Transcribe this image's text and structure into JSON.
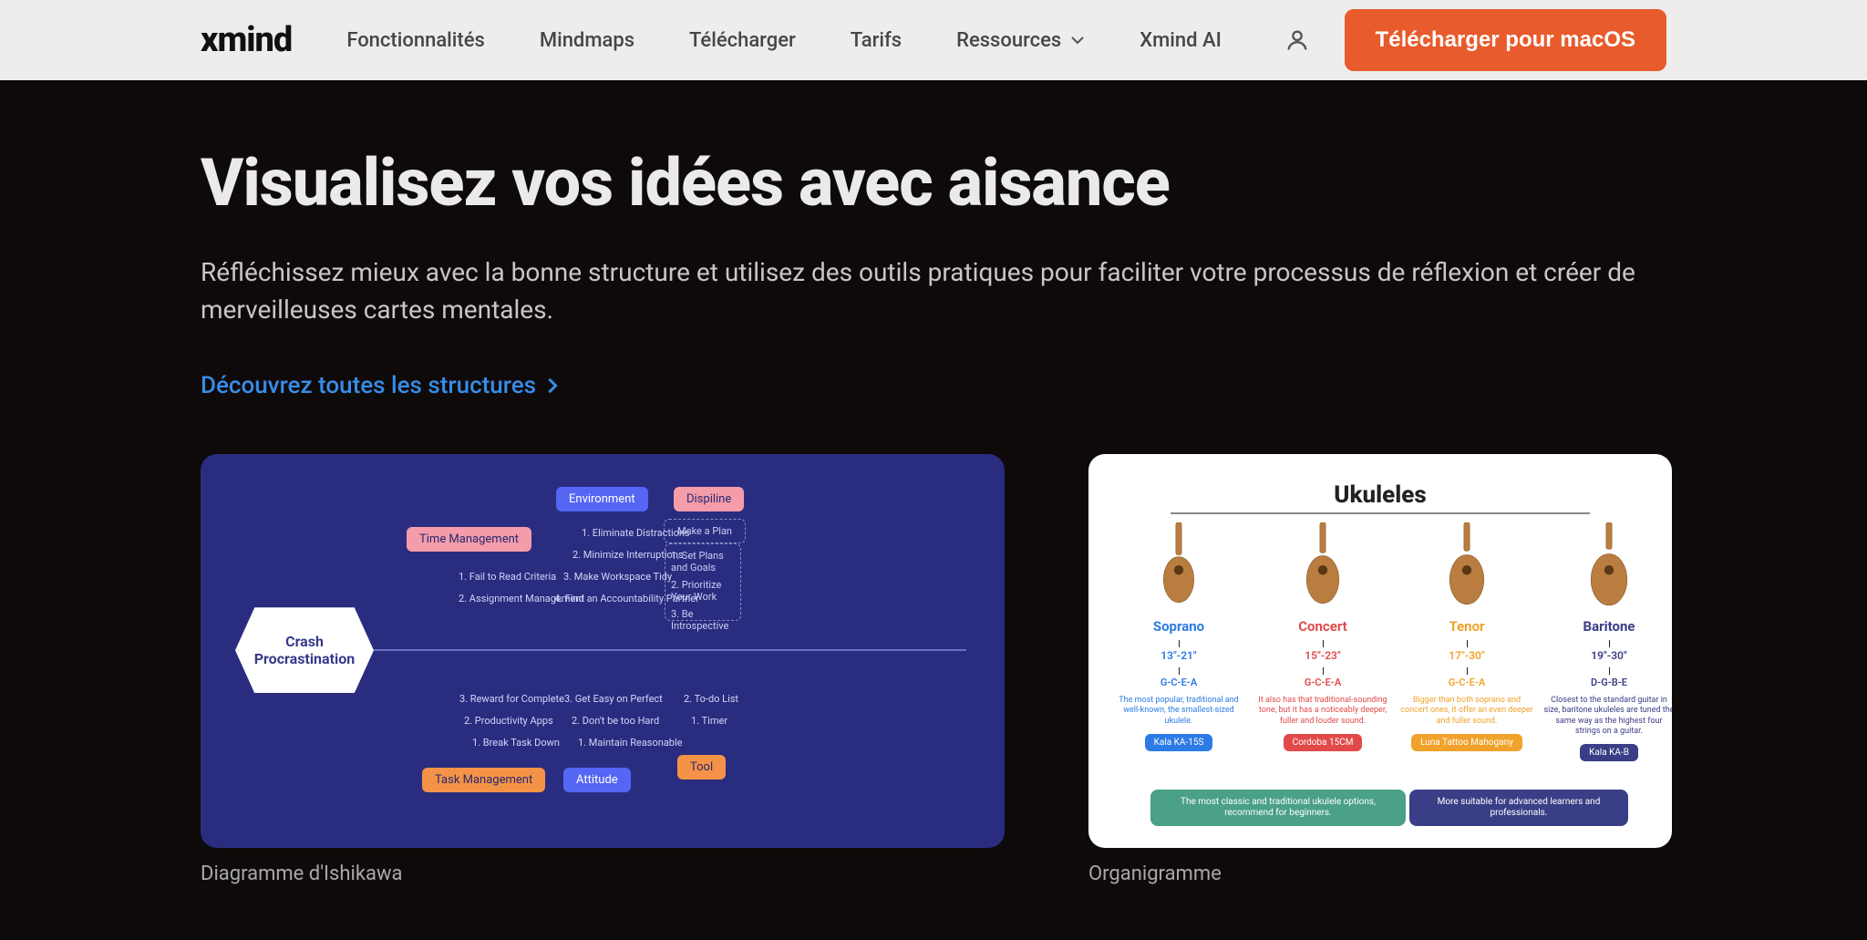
{
  "header": {
    "logo": "xmind",
    "nav": {
      "features": "Fonctionnalités",
      "mindmaps": "Mindmaps",
      "download": "Télécharger",
      "pricing": "Tarifs",
      "resources": "Ressources",
      "ai": "Xmind AI"
    },
    "cta": "Télécharger pour macOS"
  },
  "main": {
    "title": "Visualisez vos idées avec aisance",
    "desc": "Réfléchissez mieux avec la bonne structure et utilisez des outils pratiques pour faciliter votre processus de réflexion et créer de merveilleuses cartes mentales.",
    "discover": "Découvrez toutes les structures"
  },
  "card1": {
    "caption": "Diagramme d'Ishikawa",
    "root": "Crash Procrastination",
    "branches": {
      "time_management": "Time Management",
      "task_management": "Task Management",
      "environment": "Environment",
      "attitude": "Attitude",
      "dispiline": "Dispiline",
      "tool": "Tool"
    },
    "leaves": {
      "fail_read": "1. Fail to Read Criteria",
      "assignment": "2. Assignment Management",
      "reward": "3. Reward for Complete",
      "productivity": "2. Productivity Apps",
      "break_task": "1. Break Task Down",
      "eliminate": "1. Eliminate Distractions",
      "minimize": "2. Minimize Interruptions",
      "tidy": "3. Make Workspace Tidy",
      "partner": "4. Find an Accountability Partner",
      "easy": "3. Get Easy on Perfect",
      "nothard": "2. Don't be too Hard",
      "maintain": "1. Maintain Reasonable",
      "make_plan": "Make a Plan",
      "set_plans": "1. Set Plans and Goals",
      "prioritize": "2. Prioritize Your Work",
      "introspective": "3. Be Introspective",
      "todo": "2. To-do List",
      "timer": "1. Timer"
    }
  },
  "card2": {
    "caption": "Organigramme",
    "title": "Ukuleles",
    "cols": [
      {
        "name": "Soprano",
        "size": "13\"-21\"",
        "tune": "G-C-E-A",
        "desc": "The most popular, traditional and well-known, the smallest-sized ukulele.",
        "model": "Kala KA-15S"
      },
      {
        "name": "Concert",
        "size": "15\"-23\"",
        "tune": "G-C-E-A",
        "desc": "It also has that traditional-sounding tone, but it has a noticeably deeper, fuller and louder sound.",
        "model": "Cordoba 15CM"
      },
      {
        "name": "Tenor",
        "size": "17\"-30\"",
        "tune": "G-C-E-A",
        "desc": "Bigger than both soprano and concert ones, it offer an even deeper and fuller sound.",
        "model": "Luna Tattoo Mahogany"
      },
      {
        "name": "Baritone",
        "size": "19\"-30\"",
        "tune": "D-G-B-E",
        "desc": "Closest to the standard guitar in size, baritone ukuleles are tuned the same way as the highest four strings on a guitar.",
        "model": "Kala KA-B"
      }
    ],
    "footer1": "The most classic and traditional ukulele options, recommend for beginners.",
    "footer2": "More suitable for advanced learners and professionals."
  }
}
